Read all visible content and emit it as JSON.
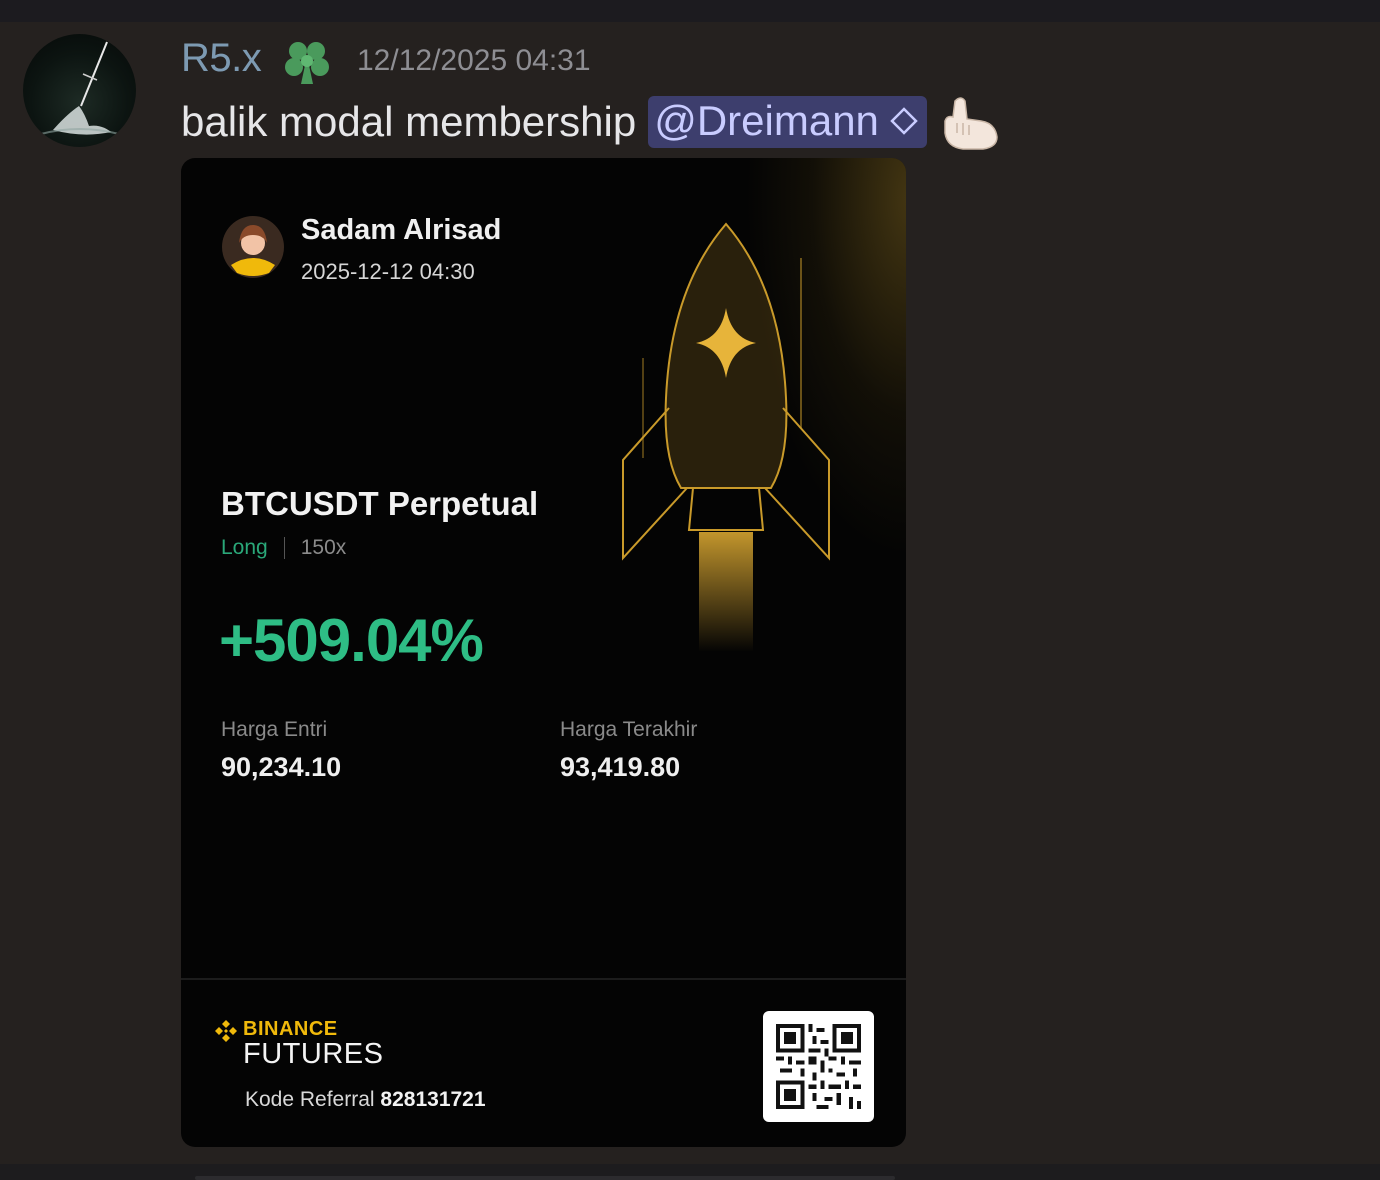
{
  "message": {
    "author": "R5.x",
    "timestamp": "12/12/2025 04:31",
    "text": "balik modal membership",
    "mention": "@Dreimann",
    "author_role_icon": "clover-icon",
    "emoji": "call-me-hand-emoji"
  },
  "trade_card": {
    "trader_name": "Sadam Alrisad",
    "trade_time": "2025-12-12 04:30",
    "pair": "BTCUSDT Perpetual",
    "side": "Long",
    "leverage": "150x",
    "roe": "+509.04%",
    "entry_label": "Harga Entri",
    "entry_value": "90,234.10",
    "last_label": "Harga Terakhir",
    "last_value": "93,419.80",
    "brand": "BINANCE",
    "product": "FUTURES",
    "referral_label": "Kode Referral",
    "referral_code": "828131721"
  },
  "colors": {
    "username": "#7d9ab2",
    "mention_bg": "#3d3e6d",
    "profit_green": "#2ebd85",
    "binance_gold": "#f0b90b"
  }
}
